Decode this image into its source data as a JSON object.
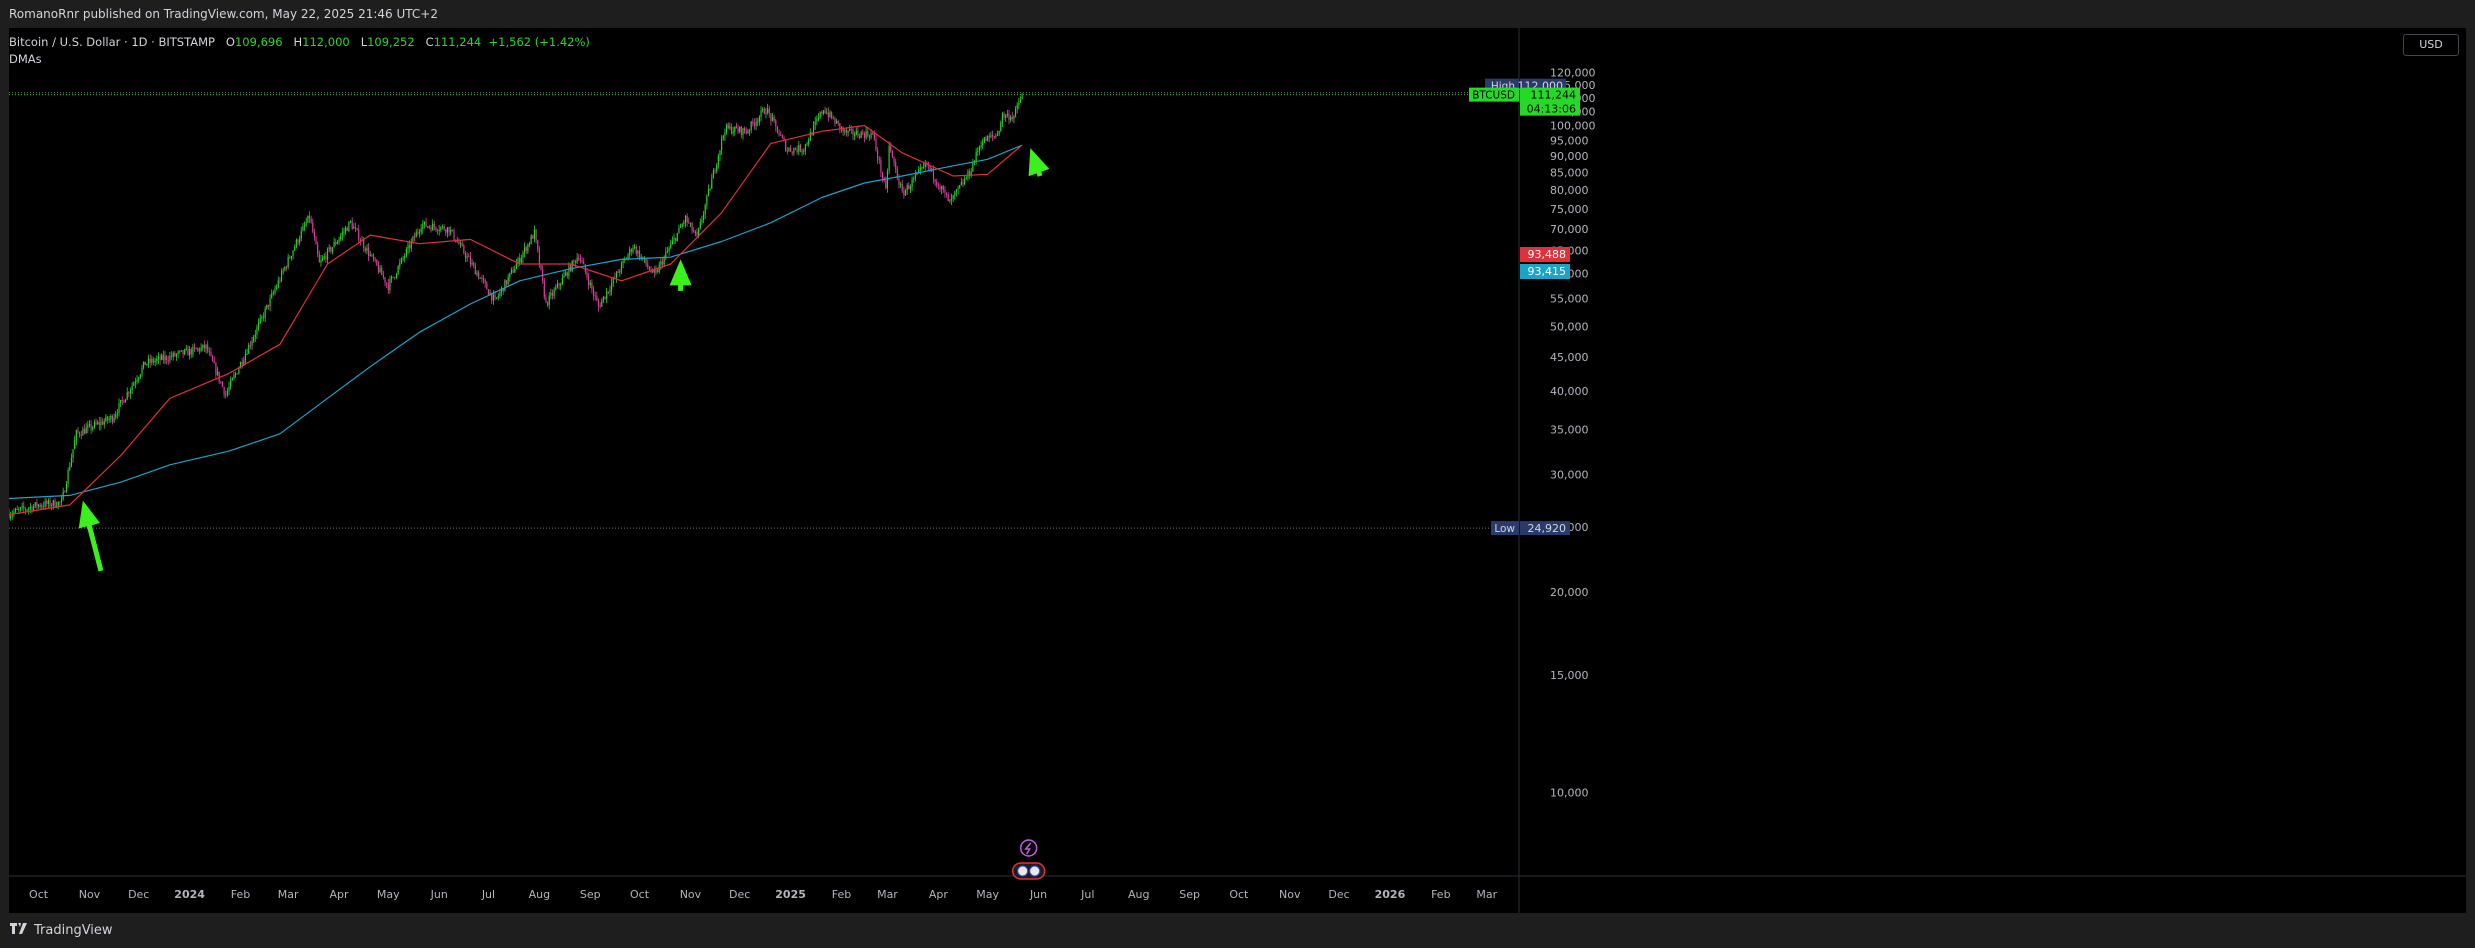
{
  "header": {
    "published": "RomanoRnr published on TradingView.com, May 22, 2025 21:46 UTC+2"
  },
  "legend": {
    "symbol": "Bitcoin / U.S. Dollar · 1D · BITSTAMP",
    "open_label": "O",
    "open": "109,696",
    "high_label": "H",
    "high": "112,000",
    "low_label": "L",
    "low": "109,252",
    "close_label": "C",
    "close": "111,244",
    "change": "+1,562 (+1.42%)",
    "indicator": "DMAs"
  },
  "price_scale": {
    "currency": "USD",
    "high_tag": "High",
    "high_value": "112,000",
    "symbol_tag": "BTCUSD",
    "last_value": "111,244",
    "countdown": "04:13:06",
    "ma_red_value": "93,488",
    "ma_blue_value": "93,415",
    "low_tag": "Low",
    "low_value": "24,920"
  },
  "footer": {
    "brand": "TradingView"
  },
  "colors": {
    "up": "#26d926",
    "down": "#e040a0",
    "ma_fast": "#e0303c",
    "ma_slow": "#1ba3c8",
    "arrow": "#3cf01e",
    "background": "#000000"
  },
  "chart_data": {
    "type": "candlestick",
    "symbol": "BTCUSD",
    "timeframe": "1D",
    "exchange": "BITSTAMP",
    "y_scale": "log",
    "ylim": [
      7500,
      140000
    ],
    "y_ticks": [
      10000,
      15000,
      20000,
      25000,
      30000,
      35000,
      40000,
      45000,
      50000,
      55000,
      60000,
      65000,
      70000,
      75000,
      80000,
      85000,
      90000,
      95000,
      100000,
      105000,
      110000,
      115000,
      120000
    ],
    "y_tick_labels": [
      "10,000",
      "15,000",
      "20,000",
      "25,000",
      "30,000",
      "35,000",
      "40,000",
      "45,000",
      "50,000",
      "55,000",
      "60,000",
      "65,000",
      "70,000",
      "75,000",
      "80,000",
      "85,000",
      "90,000",
      "95,000",
      "100,000",
      "105,000",
      "110,000",
      "115,000",
      "120,000"
    ],
    "x_ticks": [
      "Oct",
      "Nov",
      "Dec",
      "2024",
      "Feb",
      "Mar",
      "Apr",
      "May",
      "Jun",
      "Jul",
      "Aug",
      "Sep",
      "Oct",
      "Nov",
      "Dec",
      "2025",
      "Feb",
      "Mar",
      "Apr",
      "May",
      "Jun",
      "Jul",
      "Aug",
      "Sep",
      "Oct",
      "Nov",
      "Dec",
      "2026",
      "Feb",
      "Mar"
    ],
    "x_range": [
      "2023-09-13",
      "2026-03-20"
    ],
    "price_anchors": [
      {
        "date": "2023-09-13",
        "close": 26200
      },
      {
        "date": "2023-10-01",
        "close": 27000
      },
      {
        "date": "2023-10-15",
        "close": 27200
      },
      {
        "date": "2023-10-24",
        "close": 34500
      },
      {
        "date": "2023-11-15",
        "close": 36500
      },
      {
        "date": "2023-12-05",
        "close": 44000
      },
      {
        "date": "2024-01-11",
        "close": 46500
      },
      {
        "date": "2024-01-23",
        "close": 39500
      },
      {
        "date": "2024-02-15",
        "close": 52000
      },
      {
        "date": "2024-03-05",
        "close": 66000
      },
      {
        "date": "2024-03-14",
        "close": 73000
      },
      {
        "date": "2024-03-20",
        "close": 62000
      },
      {
        "date": "2024-04-08",
        "close": 71500
      },
      {
        "date": "2024-05-01",
        "close": 57500
      },
      {
        "date": "2024-05-21",
        "close": 71000
      },
      {
        "date": "2024-06-07",
        "close": 70000
      },
      {
        "date": "2024-07-05",
        "close": 54500
      },
      {
        "date": "2024-07-29",
        "close": 69000
      },
      {
        "date": "2024-08-05",
        "close": 54000
      },
      {
        "date": "2024-08-25",
        "close": 64000
      },
      {
        "date": "2024-09-06",
        "close": 53500
      },
      {
        "date": "2024-09-27",
        "close": 66000
      },
      {
        "date": "2024-10-10",
        "close": 59500
      },
      {
        "date": "2024-10-29",
        "close": 72500
      },
      {
        "date": "2024-11-05",
        "close": 67800
      },
      {
        "date": "2024-11-22",
        "close": 99000
      },
      {
        "date": "2024-12-05",
        "close": 98000
      },
      {
        "date": "2024-12-17",
        "close": 106000
      },
      {
        "date": "2024-12-30",
        "close": 92000
      },
      {
        "date": "2025-01-09",
        "close": 92500
      },
      {
        "date": "2025-01-21",
        "close": 106000
      },
      {
        "date": "2025-02-03",
        "close": 97500
      },
      {
        "date": "2025-02-20",
        "close": 97000
      },
      {
        "date": "2025-02-28",
        "close": 79500
      },
      {
        "date": "2025-03-02",
        "close": 93000
      },
      {
        "date": "2025-03-10",
        "close": 79000
      },
      {
        "date": "2025-03-25",
        "close": 87500
      },
      {
        "date": "2025-04-08",
        "close": 76500
      },
      {
        "date": "2025-04-20",
        "close": 85000
      },
      {
        "date": "2025-04-27",
        "close": 94500
      },
      {
        "date": "2025-05-07",
        "close": 97000
      },
      {
        "date": "2025-05-10",
        "close": 103500
      },
      {
        "date": "2025-05-17",
        "close": 103200
      },
      {
        "date": "2025-05-22",
        "close": 111244
      }
    ],
    "ma_fast": {
      "color": "red",
      "last": 93488,
      "points": [
        {
          "date": "2023-09-13",
          "value": 26100
        },
        {
          "date": "2023-10-20",
          "value": 27000
        },
        {
          "date": "2023-11-20",
          "value": 32000
        },
        {
          "date": "2023-12-20",
          "value": 39000
        },
        {
          "date": "2024-01-25",
          "value": 42500
        },
        {
          "date": "2024-02-25",
          "value": 47000
        },
        {
          "date": "2024-03-25",
          "value": 62000
        },
        {
          "date": "2024-04-20",
          "value": 68500
        },
        {
          "date": "2024-05-20",
          "value": 66500
        },
        {
          "date": "2024-06-20",
          "value": 67500
        },
        {
          "date": "2024-07-20",
          "value": 62000
        },
        {
          "date": "2024-08-20",
          "value": 62000
        },
        {
          "date": "2024-09-20",
          "value": 58500
        },
        {
          "date": "2024-10-20",
          "value": 62000
        },
        {
          "date": "2024-11-20",
          "value": 74000
        },
        {
          "date": "2024-12-20",
          "value": 94000
        },
        {
          "date": "2025-01-20",
          "value": 98000
        },
        {
          "date": "2025-02-15",
          "value": 100000
        },
        {
          "date": "2025-03-10",
          "value": 91000
        },
        {
          "date": "2025-04-10",
          "value": 84000
        },
        {
          "date": "2025-05-01",
          "value": 84500
        },
        {
          "date": "2025-05-22",
          "value": 93488
        }
      ]
    },
    "ma_slow": {
      "color": "cyan",
      "last": 93415,
      "points": [
        {
          "date": "2023-09-13",
          "value": 27600
        },
        {
          "date": "2023-10-20",
          "value": 27900
        },
        {
          "date": "2023-11-20",
          "value": 29200
        },
        {
          "date": "2023-12-20",
          "value": 31000
        },
        {
          "date": "2024-01-25",
          "value": 32500
        },
        {
          "date": "2024-02-25",
          "value": 34500
        },
        {
          "date": "2024-03-25",
          "value": 39000
        },
        {
          "date": "2024-04-20",
          "value": 43500
        },
        {
          "date": "2024-05-20",
          "value": 49000
        },
        {
          "date": "2024-06-20",
          "value": 54000
        },
        {
          "date": "2024-07-20",
          "value": 58500
        },
        {
          "date": "2024-08-20",
          "value": 61000
        },
        {
          "date": "2024-09-20",
          "value": 63000
        },
        {
          "date": "2024-10-20",
          "value": 63500
        },
        {
          "date": "2024-11-20",
          "value": 67000
        },
        {
          "date": "2024-12-20",
          "value": 71500
        },
        {
          "date": "2025-01-20",
          "value": 78000
        },
        {
          "date": "2025-02-15",
          "value": 82000
        },
        {
          "date": "2025-03-10",
          "value": 84000
        },
        {
          "date": "2025-04-10",
          "value": 87000
        },
        {
          "date": "2025-05-01",
          "value": 89000
        },
        {
          "date": "2025-05-22",
          "value": 93415
        }
      ]
    },
    "levels": [
      {
        "label": "High",
        "value": 112000
      },
      {
        "label": "Low",
        "value": 24920
      }
    ],
    "annotations": [
      {
        "type": "arrow",
        "date": "2023-11-08",
        "value": 21500,
        "target_date": "2023-10-28",
        "target_value": 27400
      },
      {
        "type": "arrow",
        "date": "2024-10-26",
        "value": 56500,
        "target_date": "2024-10-26",
        "target_value": 63000
      },
      {
        "type": "arrow",
        "date": "2025-06-02",
        "value": 84000,
        "target_date": "2025-05-27",
        "target_value": 92500
      }
    ]
  }
}
